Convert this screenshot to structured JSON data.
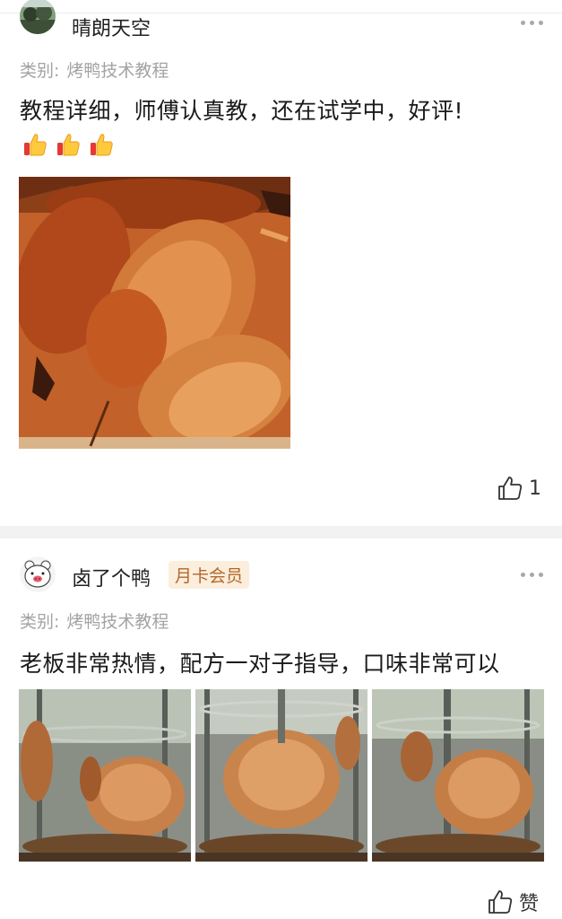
{
  "reviews": [
    {
      "username": "晴朗天空",
      "badge": "",
      "category_label": "类别:",
      "category_value": "烤鸭技术教程",
      "text": "教程详细，师傅认真教，还在试学中，好评!",
      "emoji_count": 3,
      "emoji_icon": "thumbs-up-emoji",
      "photos": [
        "roast-duck-platter"
      ],
      "like_label": "1"
    },
    {
      "username": "卤了个鸭",
      "badge": "月卡会员",
      "category_label": "类别:",
      "category_value": "烤鸭技术教程",
      "text": "老板非常热情，配方一对子指导，口味非常可以",
      "photos": [
        "duck-oven-1",
        "duck-oven-2",
        "duck-oven-3"
      ],
      "like_label": "赞"
    }
  ],
  "colors": {
    "category_gray": "#a3a3a3",
    "badge_text": "#b3672a",
    "badge_bg": "#fbeedd",
    "divider": "#f2f2f2"
  }
}
